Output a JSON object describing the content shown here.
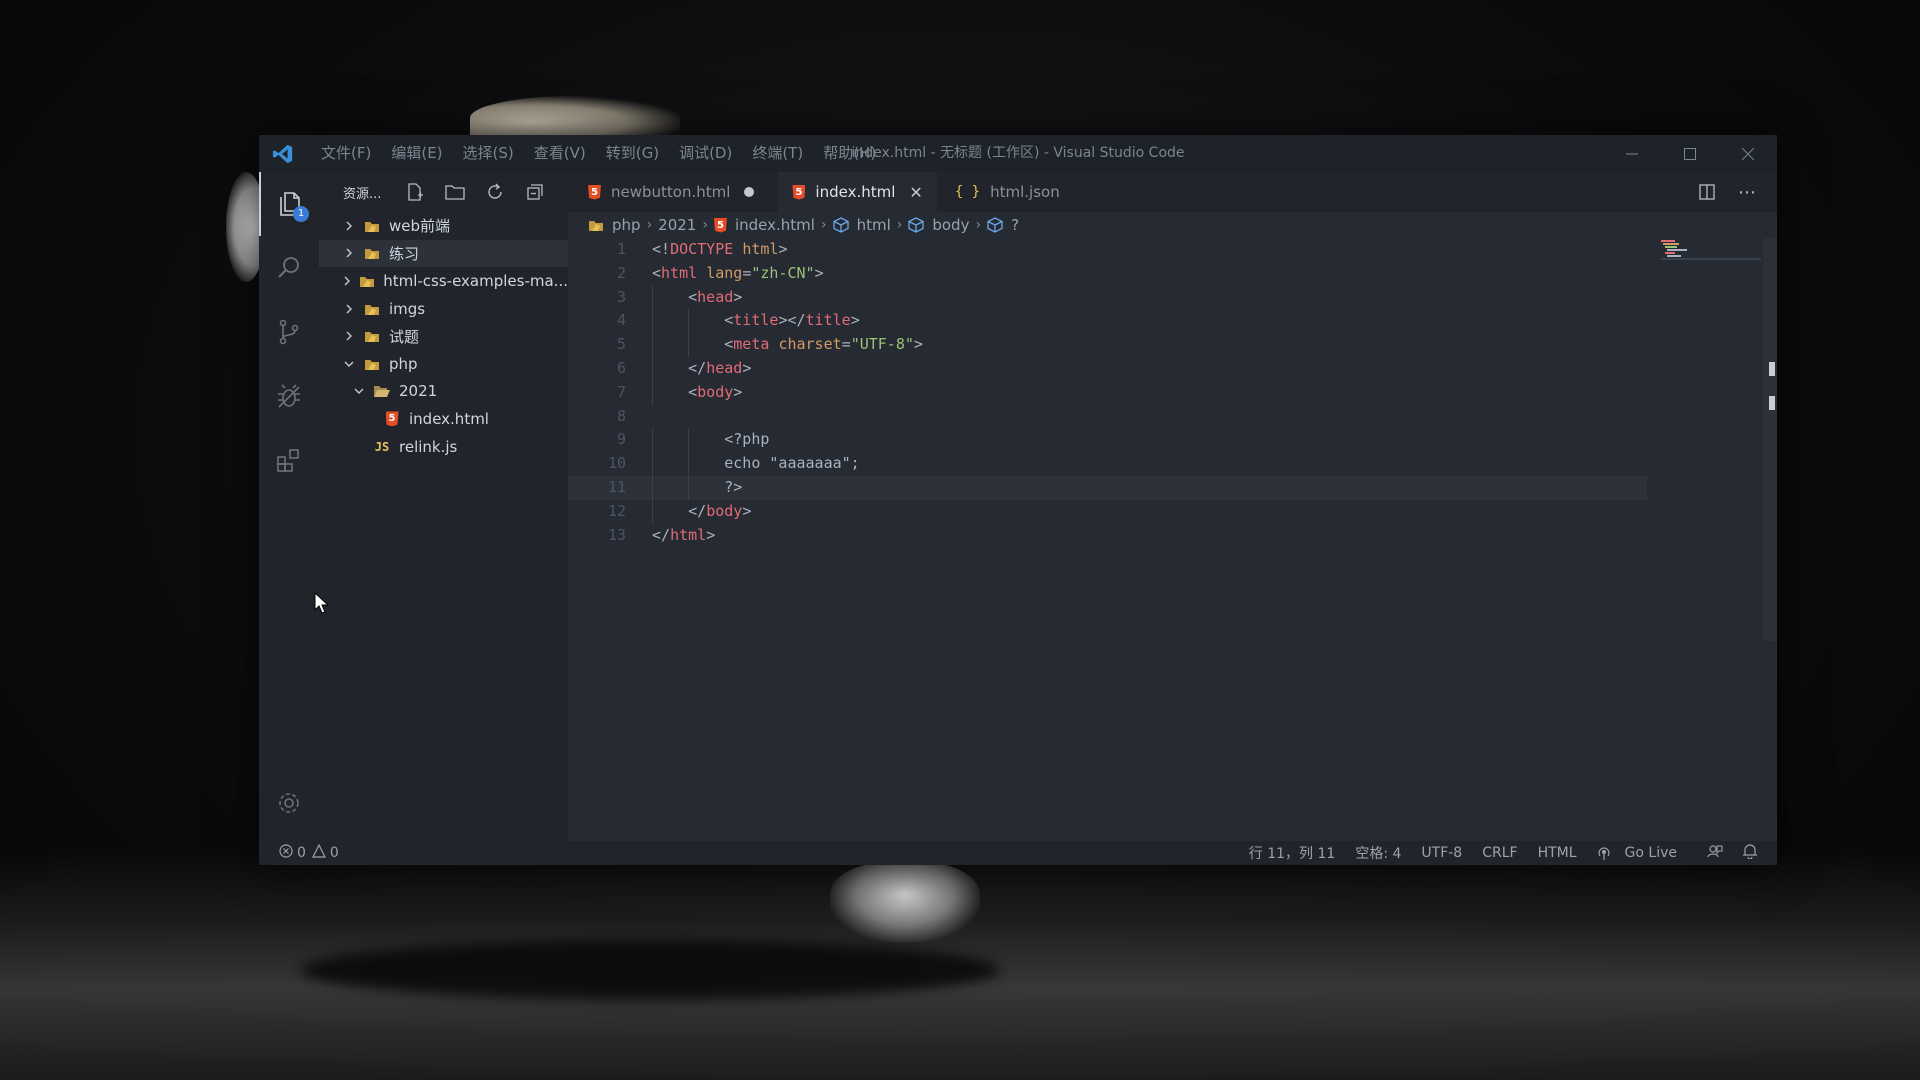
{
  "window": {
    "title": "index.html - 无标题 (工作区) - Visual Studio Code",
    "menu": [
      "文件(F)",
      "编辑(E)",
      "选择(S)",
      "查看(V)",
      "转到(G)",
      "调试(D)",
      "终端(T)",
      "帮助(H)"
    ]
  },
  "activity_bar": {
    "items": [
      "explorer-icon",
      "search-icon",
      "source-control-icon",
      "debug-icon",
      "extensions-icon"
    ],
    "explorer_badge": "1",
    "bottom": "gear-icon"
  },
  "sidebar": {
    "title": "资源...",
    "tree": [
      {
        "label": "web前端",
        "type": "folder"
      },
      {
        "label": "练习",
        "type": "folder"
      },
      {
        "label": "html-css-examples-ma...",
        "type": "folder"
      },
      {
        "label": "imgs",
        "type": "folder"
      },
      {
        "label": "试题",
        "type": "folder"
      },
      {
        "label": "php",
        "type": "folder-open"
      },
      {
        "label": "2021",
        "type": "folder-open"
      },
      {
        "label": "index.html",
        "type": "html"
      },
      {
        "label": "relink.js",
        "type": "js"
      }
    ]
  },
  "tabs": [
    {
      "label": "newbutton.html",
      "state": "modified"
    },
    {
      "label": "index.html",
      "state": "active"
    },
    {
      "label": "html.json",
      "state": "normal"
    }
  ],
  "breadcrumb": [
    "php",
    "2021",
    "index.html",
    "html",
    "body",
    "?"
  ],
  "code": {
    "line_numbers": [
      "1",
      "2",
      "3",
      "4",
      "5",
      "6",
      "7",
      "8",
      "9",
      "10",
      "11",
      "12",
      "13"
    ],
    "lines": [
      "<!DOCTYPE html>",
      "<html lang=\"zh-CN\">",
      "    <head>",
      "        <title></title>",
      "        <meta charset=\"UTF-8\">",
      "    </head>",
      "    <body>",
      "",
      "        <?php",
      "        echo \"aaaaaaa\";",
      "        ?>",
      "    </body>",
      "</html>"
    ],
    "current_line": 11
  },
  "status": {
    "errors": "0",
    "warnings": "0",
    "position": "行 11，列 11",
    "spaces": "空格: 4",
    "encoding": "UTF-8",
    "eol": "CRLF",
    "language": "HTML",
    "live": "Go Live"
  },
  "colors": {
    "accent": "#3a7bd5",
    "tag": "#e06c75",
    "attr": "#d19a66",
    "string": "#98c379",
    "html_icon": "#e44d26",
    "folder_icon": "#e5c158"
  }
}
